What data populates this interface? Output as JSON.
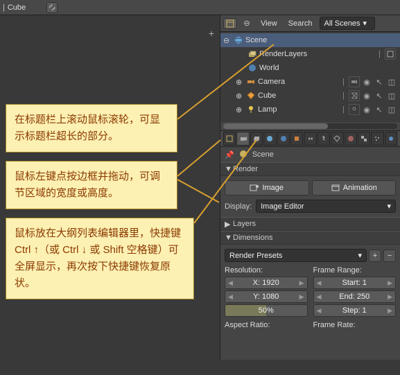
{
  "topbar": {
    "name": "Cube"
  },
  "outliner": {
    "view": "View",
    "search": "Search",
    "filter": "All Scenes",
    "scene": "Scene",
    "items": [
      {
        "name": "RenderLayers",
        "icon": "layers"
      },
      {
        "name": "World",
        "icon": "world"
      },
      {
        "name": "Camera",
        "icon": "camera"
      },
      {
        "name": "Cube",
        "icon": "mesh"
      },
      {
        "name": "Lamp",
        "icon": "lamp"
      }
    ]
  },
  "tips": {
    "t1": "在标题栏上滚动鼠标滚轮，可显示标题栏超长的部分。",
    "t2": "鼠标左键点按边框并拖动，可调节区域的宽度或高度。",
    "t3": "鼠标放在大纲列表编辑器里，快捷键 Ctrl ↑（或 Ctrl ↓ 或 Shift 空格键）可全屏显示，再次按下快捷键恢复原状。"
  },
  "props": {
    "breadcrumb": "Scene",
    "render_panel": "Render",
    "image_btn": "Image",
    "anim_btn": "Animation",
    "display_label": "Display:",
    "display_value": "Image Editor",
    "layers_panel": "Layers",
    "dims_panel": "Dimensions",
    "presets": "Render Presets",
    "resolution_label": "Resolution:",
    "framerange_label": "Frame Range:",
    "res_x": "X: 1920",
    "res_y": "Y: 1080",
    "res_pct": "50%",
    "start": "Start: 1",
    "end": "End: 250",
    "step": "Step: 1",
    "aspect_label": "Aspect Ratio:",
    "framerate_label": "Frame Rate:"
  }
}
